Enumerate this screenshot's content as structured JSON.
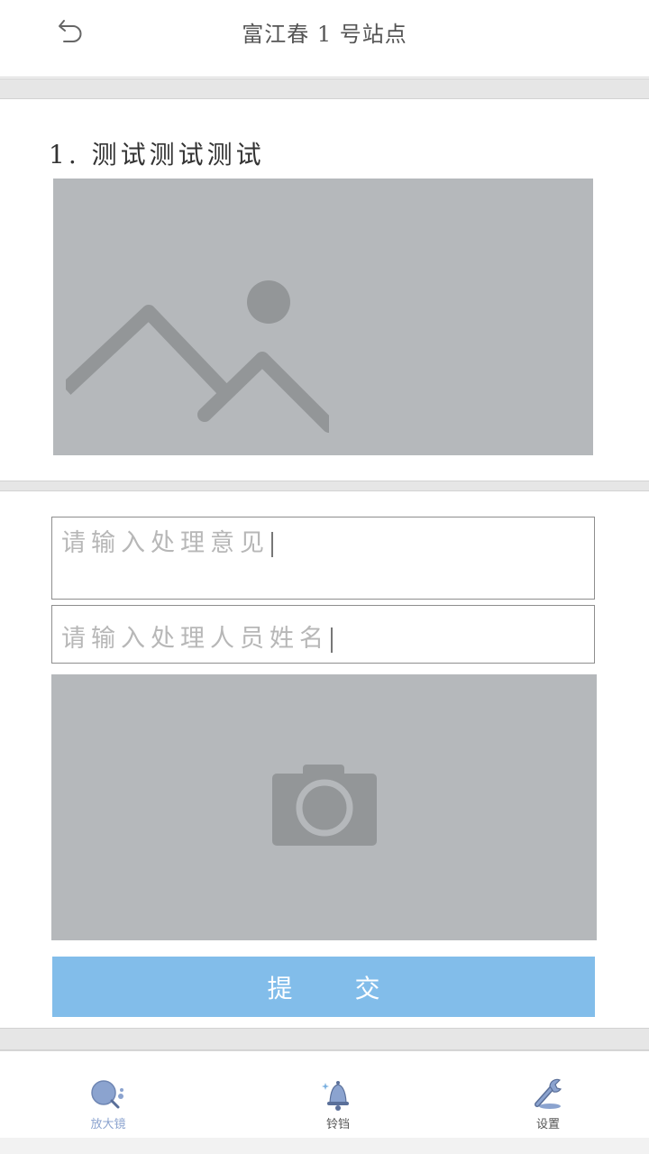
{
  "header": {
    "title": "富江春 1 号站点",
    "back_icon": "undo-arrow-icon"
  },
  "task": {
    "title": "1. 测试测试测试",
    "image_icon": "image-placeholder-icon"
  },
  "form": {
    "opinion_placeholder": "请输入处理意见",
    "name_placeholder": "请输入处理人员姓名",
    "photo_icon": "camera-icon",
    "submit_label": "提 交"
  },
  "colors": {
    "accent": "#82bdea",
    "placeholder_gray": "#b5b8bb",
    "icon_gray": "#939698",
    "nav_active": "#8ba3cf"
  },
  "bottom_nav": {
    "items": [
      {
        "label": "放大镜",
        "icon": "magnifier-icon",
        "active": true
      },
      {
        "label": "铃铛",
        "icon": "bell-icon",
        "active": false
      },
      {
        "label": "设置",
        "icon": "wrench-icon",
        "active": false
      }
    ]
  }
}
